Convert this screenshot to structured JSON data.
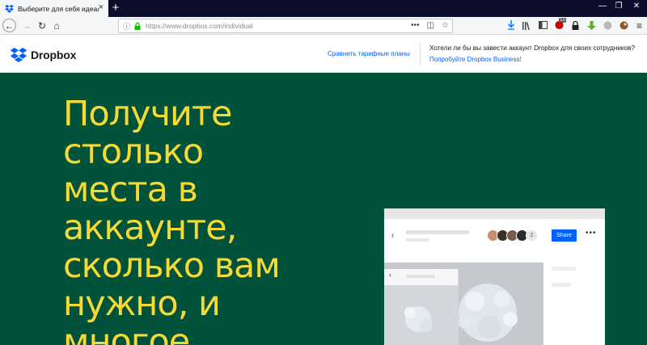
{
  "browser": {
    "tab_title": "Выберите для себя идеальное",
    "tab_close": "×",
    "new_tab": "+",
    "window_controls": [
      "—",
      "❐",
      "✕"
    ],
    "back": "←",
    "forward": "→",
    "reload": "↻",
    "home": "⌂",
    "url": "https://www.dropbox.com/individual",
    "url_actions": [
      "•••",
      "◫",
      "☆"
    ],
    "toolbar_icons": [
      "download-icon",
      "library-icon",
      "sidebar-icon",
      "addon-badge-icon",
      "lock-icon",
      "addon-green-icon",
      "addon-gray-icon",
      "addon-brown-icon"
    ],
    "addon_badge": "15",
    "menu": "≡"
  },
  "site": {
    "logo_text": "Dropbox",
    "compare_plans": "Сравнить тарифные планы",
    "business_question": "Хотели ли бы вы завести аккаунт Dropbox для своих сотрудников?",
    "business_link": "Попробуйте Dropbox Business!"
  },
  "hero": {
    "title_lines": [
      "Получите",
      "столько",
      "места в",
      "аккаунте,",
      "сколько вам",
      "нужно, и",
      "многое"
    ]
  },
  "preview": {
    "back": "‹",
    "share_label": "Share",
    "more": "•••",
    "avatar_count": "2",
    "avatar_colors": [
      "#c98f6e",
      "#3b2f2a",
      "#7a5a4a",
      "#2e2a28"
    ]
  },
  "colors": {
    "hero_bg": "#00533a",
    "hero_text": "#f7d934",
    "link": "#0061fe",
    "brand_blue": "#0061fe"
  }
}
